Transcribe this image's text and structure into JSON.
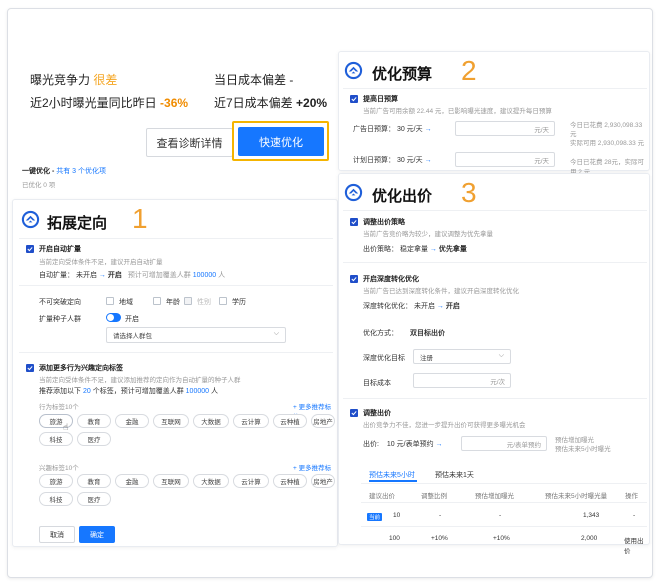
{
  "top": {
    "exposure_label": "曝光竞争力",
    "exposure_value": "很差",
    "cost_label": "当日成本偏差",
    "cost_value": "-",
    "hour_label": "近2小时曝光量同比昨日",
    "hour_value": "-36%",
    "week_label": "近7日成本偏差",
    "week_value": "+20%",
    "diagnose_btn": "查看诊断详情",
    "fast_btn": "快速优化",
    "one_key_label": "一键优化 -",
    "one_key_count": "共有 3 个优化项",
    "optimized": "已优化 0 项"
  },
  "p1": {
    "title": "拓展定向",
    "num": "1",
    "auto_expand": "开启自动扩量",
    "auto_expand_desc": "当前定向受体条件不足，建议开启自动扩量",
    "auto_label": "自动扩量：",
    "auto_from": "未开启",
    "auto_to": "开启",
    "auto_note": "预计可增加覆盖人群",
    "auto_num": "100000",
    "auto_unit": "人",
    "nb_label": "不可突破定向",
    "nb_opts": [
      "地域",
      "年龄",
      "性别",
      "学历"
    ],
    "seed_label": "扩量种子人群",
    "seed_toggle": "开启",
    "seed_placeholder": "请选择人群包",
    "add_tags": "添加更多行为兴趣定向标签",
    "add_tags_desc": "当前定向受体条件不足，建议添加推荐的定向作为自动扩量的种子人群",
    "rec_text_a": "推荐添加以下",
    "rec_num": "20",
    "rec_text_b": "个标签，预计可增加覆盖人群",
    "rec_people": "100000",
    "rec_unit": "人",
    "behav_label": "行为标签10个",
    "more_behav": "+ 更多推荐标签",
    "behav_tags": [
      "旅游",
      "教育",
      "金融",
      "互联网",
      "大数据",
      "云计算",
      "云种植",
      "房地产",
      "科技",
      "医疗"
    ],
    "interest_label": "兴趣标签10个",
    "more_interest": "+ 更多推荐标签",
    "interest_tags": [
      "旅游",
      "教育",
      "金融",
      "互联网",
      "大数据",
      "云计算",
      "云种植",
      "房地产",
      "科技",
      "医疗"
    ],
    "cancel": "取消",
    "confirm": "确定"
  },
  "p2": {
    "title": "优化预算",
    "num": "2",
    "raise": "提高日预算",
    "raise_desc": "当前广告可用余额 22.44 元，已影响曝光速度，建议提升每日预算",
    "ad_label": "广告日预算：",
    "ad_val": "30 元/天",
    "ad_unit": "元/天",
    "plan_label": "计划日预算：",
    "plan_val": "30 元/天",
    "plan_unit": "元/天",
    "spent_a": "今日已花费 2,930,098.33 元",
    "spent_b": "实际可用 2,930,098.33 元",
    "spent_c": "今日已花费 28元，实际可用 2 元"
  },
  "p3": {
    "title": "优化出价",
    "num": "3",
    "bid_strategy": "调整出价策略",
    "bid_strategy_desc": "当前广告竞价略为较少，建议调整为优先拿量",
    "strategy_label": "出价策略：",
    "strategy_from": "稳定拿量",
    "strategy_to": "优先拿量",
    "deep": "开启深度转化优化",
    "deep_desc": "当前广告已达到深度转化条件，建议开启深度转化优化",
    "deep_label": "深度转化优化：",
    "deep_from": "未开启",
    "deep_to": "开启",
    "opt_mode_label": "优化方式：",
    "opt_mode_val": "双目标出价",
    "deep_target_label": "深度优化目标",
    "deep_target_val": "注册",
    "target_cost_label": "目标成本",
    "target_cost_unit": "元/次",
    "adjust": "调整出价",
    "adjust_desc": "出价竞争力不佳，您进一步提升出价可获得更多曝光机会",
    "bid_label": "出价:",
    "bid_val": "10 元/表单预约",
    "bid_unit": "元/表单预约",
    "est_a": "预估增加曝光",
    "est_b": "预估未来5小时曝光",
    "tab_a": "预估未来5小时",
    "tab_b": "预估未来1天",
    "headers": [
      "建议出价",
      "调整比例",
      "预估增加曝光",
      "预估未来5小时曝光量",
      "操作"
    ],
    "rows": [
      {
        "badge": "当前",
        "bid": "10",
        "ratio": "-",
        "inc": "-",
        "total": "1,343",
        "op": "-"
      },
      {
        "badge": "",
        "bid": "100",
        "ratio": "+10%",
        "inc": "+10%",
        "total": "2,000",
        "op": "使用出价"
      }
    ]
  },
  "colors": {
    "accent": "#1677ff",
    "orange": "#f0a030",
    "warn": "#f08c00"
  }
}
